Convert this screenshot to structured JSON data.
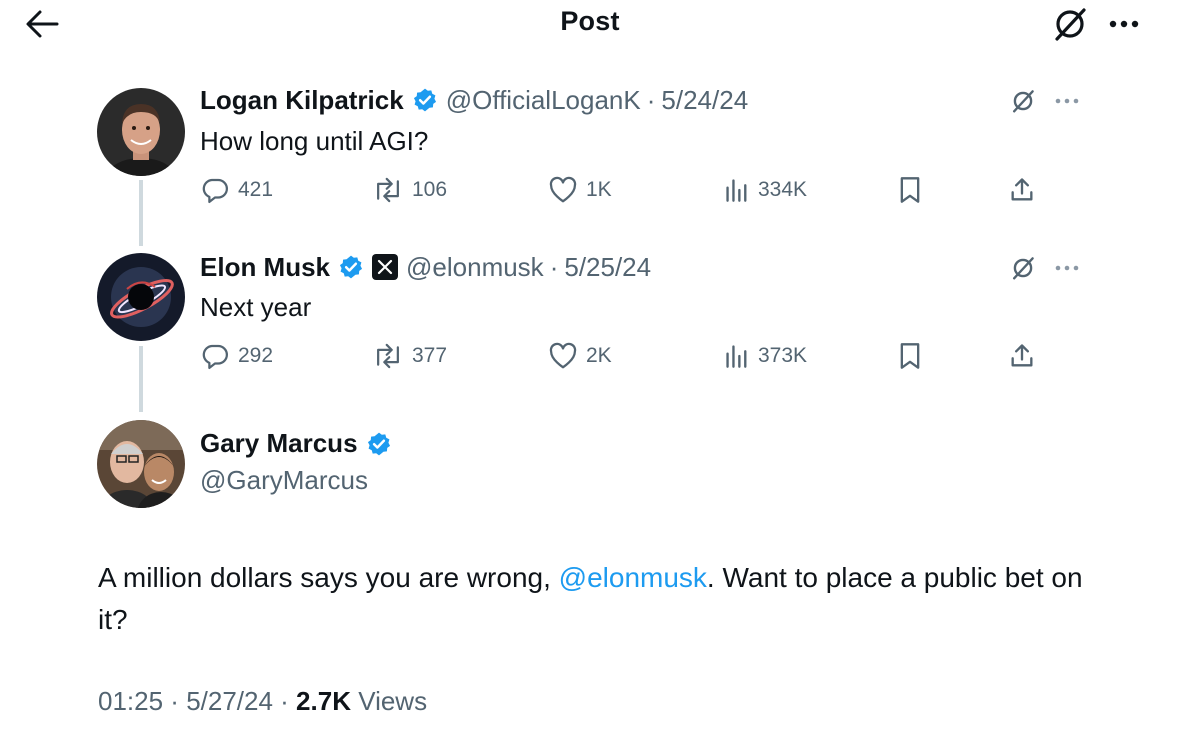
{
  "header": {
    "title": "Post"
  },
  "tweets": [
    {
      "name": "Logan Kilpatrick",
      "handle": "@OfficialLoganK",
      "separator": "·",
      "date": "5/24/24",
      "text": "How long until AGI?",
      "stats": {
        "replies": "421",
        "reposts": "106",
        "likes": "1K",
        "views": "334K"
      }
    },
    {
      "name": "Elon Musk",
      "handle": "@elonmusk",
      "separator": "·",
      "date": "5/25/24",
      "text": "Next year",
      "stats": {
        "replies": "292",
        "reposts": "377",
        "likes": "2K",
        "views": "373K"
      }
    }
  ],
  "main_tweet": {
    "name": "Gary Marcus",
    "handle": "@GaryMarcus",
    "text_before": "A million dollars says you are wrong, ",
    "mention": "@elonmusk",
    "text_after": ".  Want to place a public bet on it?",
    "time": "01:25",
    "sep1": " · ",
    "date": "5/27/24",
    "sep2": " · ",
    "views": "2.7K",
    "views_label": " Views"
  },
  "colors": {
    "accent": "#1d9bf0",
    "muted": "#536471",
    "text": "#0f1419",
    "thread_line": "#cfd9de"
  },
  "icons": [
    "back-arrow-icon",
    "grok-icon",
    "more-icon",
    "verified-badge-icon",
    "x-logo-icon",
    "reply-icon",
    "repost-icon",
    "like-icon",
    "views-icon",
    "bookmark-icon",
    "share-icon"
  ]
}
